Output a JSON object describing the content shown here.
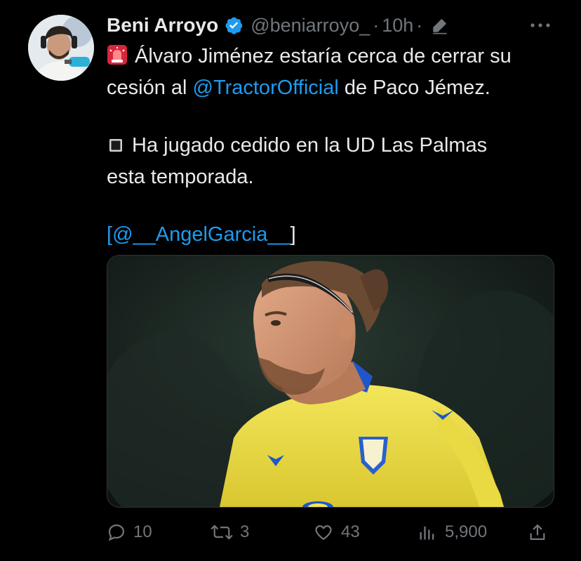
{
  "author": {
    "name": "Beni Arroyo",
    "handle": "@beniarroyo_",
    "time": "10h"
  },
  "tweet": {
    "line1_text": "Álvaro Jiménez estaría cerca de cerrar su",
    "line2_prefix": "cesión al ",
    "line2_mention": "@TractorOfficial",
    "line2_suffix": " de Paco Jémez.",
    "line3_text": "Ha jugado cedido en la UD Las Palmas",
    "line4_text": "esta temporada.",
    "credit_open": "[",
    "credit_mention": "@__AngelGarcia__",
    "credit_close": "]"
  },
  "actions": {
    "replies": "10",
    "retweets": "3",
    "likes": "43",
    "views": "5,900"
  },
  "icons": {
    "line1_emoji": "rotating-light-icon",
    "line3_emoji": "black-square-icon"
  },
  "colors": {
    "background": "#000000",
    "text": "#e7e9ea",
    "secondary": "#71767b",
    "link": "#1d9bf0",
    "verified": "#1d9bf0",
    "jersey": "#f0e04a"
  }
}
